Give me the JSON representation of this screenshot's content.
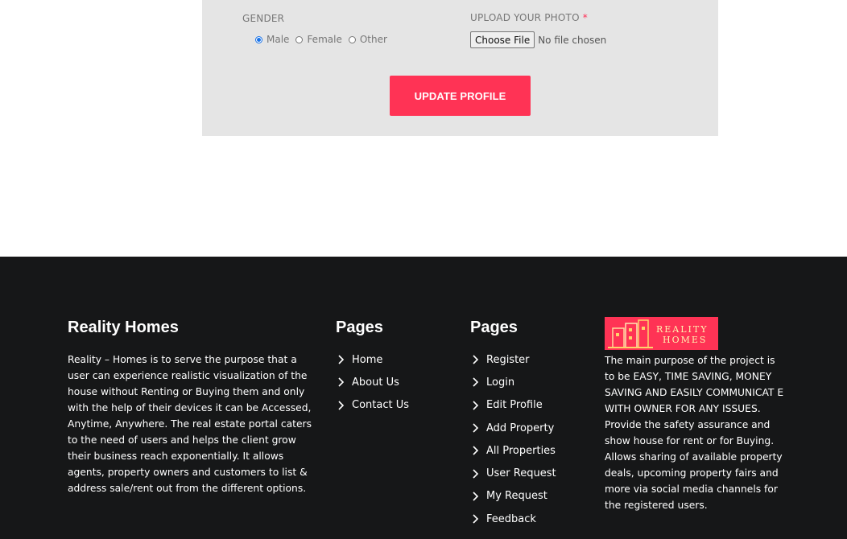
{
  "form": {
    "gender_label": "GENDER",
    "gender_options": [
      "Male",
      "Female",
      "Other"
    ],
    "gender_selected": "Male",
    "photo_label": "UPLOAD YOUR PHOTO",
    "photo_required_mark": "*",
    "file_button_label": "Choose File",
    "file_status": "No file chosen",
    "submit_label": "UPDATE PROFILE"
  },
  "footer": {
    "about": {
      "title": "Reality Homes",
      "text": "Reality – Homes is to serve the purpose that a user can experience realistic visualization of the house without Renting or Buying them and only with the help of their devices it can be Accessed, Anytime, Anywhere. The real estate portal caters to the need of users and helps the client grow their business reach exponentially. It allows agents, property owners and customers to list & address sale/rent out from the different options."
    },
    "pages1": {
      "title": "Pages",
      "links": [
        "Home",
        "About Us",
        "Contact Us"
      ]
    },
    "pages2": {
      "title": "Pages",
      "links": [
        "Register",
        "Login",
        "Edit Profile",
        "Add Property",
        "All Properties",
        "User Request",
        "My Request",
        "Feedback"
      ]
    },
    "project": {
      "logo_line1": "REALITY",
      "logo_line2": "HOMES",
      "text": "The main purpose of the project is to be EASY, TIME SAVING, MONEY SAVING AND EASILY COMMUNICAT E WITH OWNER FOR ANY ISSUES. Provide the safety assurance and show house for rent or for Buying. Allows sharing of available property deals, upcoming property fairs and more via social media channels for the registered users."
    }
  },
  "colors": {
    "accent": "#ff3355",
    "panel_bg": "#e5e5e5",
    "footer_bg": "#161718"
  }
}
